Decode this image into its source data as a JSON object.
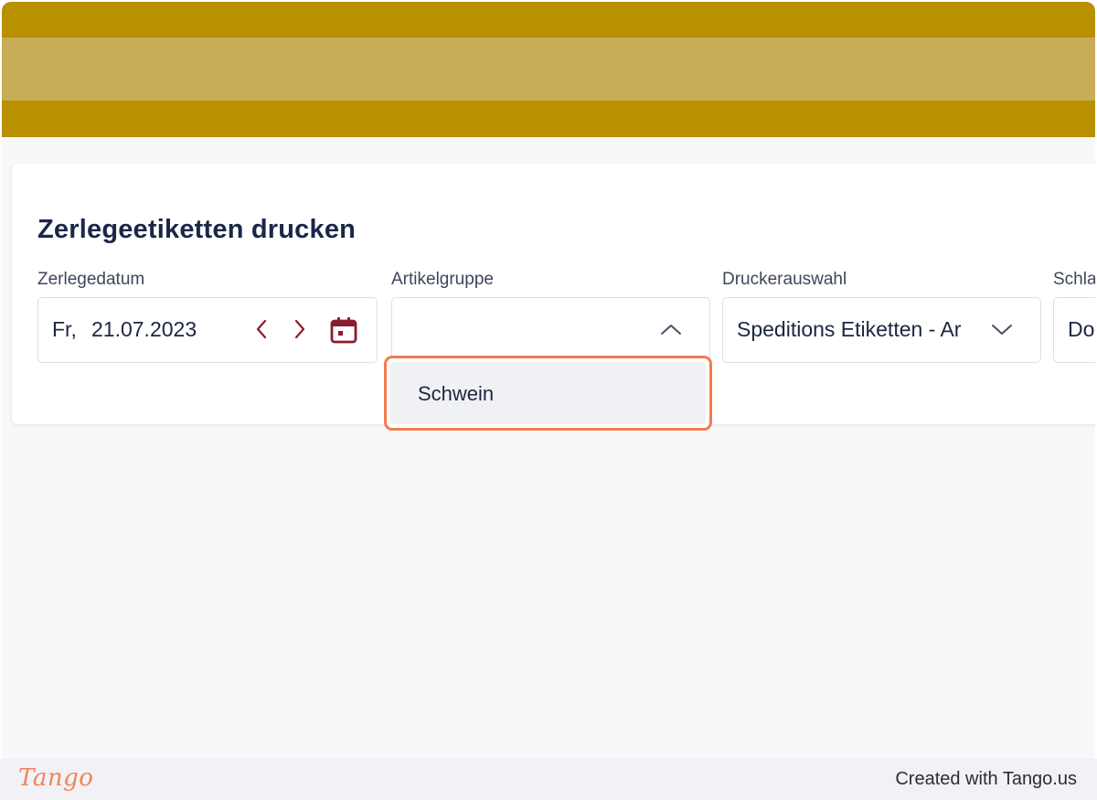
{
  "colors": {
    "banner": "#b89000",
    "banner_stripe": "#c8ac56",
    "accent_icon": "#8a1c2c",
    "highlight_border": "#f47b4f",
    "tango_brand": "#f0845a"
  },
  "page": {
    "title": "Zerlegeetiketten drucken"
  },
  "fields": {
    "zerlegedatum": {
      "label": "Zerlegedatum",
      "weekday": "Fr,",
      "date": "21.07.2023",
      "icons": [
        "chevron-left-icon",
        "chevron-right-icon",
        "calendar-icon"
      ]
    },
    "artikelgruppe": {
      "label": "Artikelgruppe",
      "value": "",
      "icon": "chevron-up-icon",
      "options": [
        "Schwein"
      ]
    },
    "druckerauswahl": {
      "label": "Druckerauswahl",
      "value": "Speditions Etiketten - Ar",
      "icon": "chevron-down-icon"
    },
    "schlachtung": {
      "label": "Schla",
      "value": "Do"
    }
  },
  "footer": {
    "logo_text": "Tango",
    "credit": "Created with Tango.us"
  }
}
